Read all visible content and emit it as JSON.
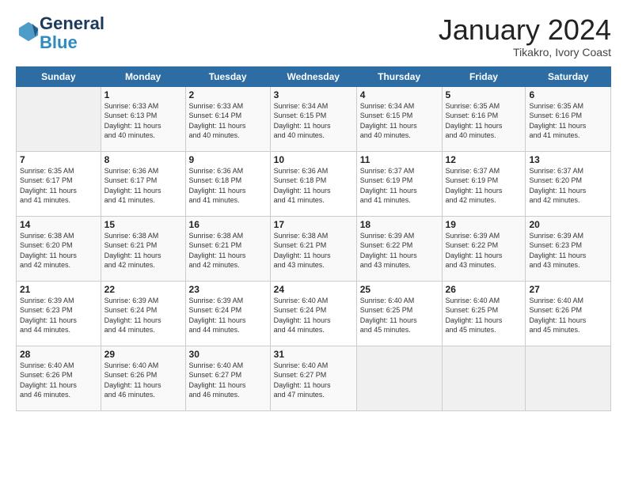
{
  "header": {
    "logo_line1": "General",
    "logo_line2": "Blue",
    "month": "January 2024",
    "location": "Tikakro, Ivory Coast"
  },
  "days_of_week": [
    "Sunday",
    "Monday",
    "Tuesday",
    "Wednesday",
    "Thursday",
    "Friday",
    "Saturday"
  ],
  "weeks": [
    [
      {
        "num": "",
        "info": ""
      },
      {
        "num": "1",
        "info": "Sunrise: 6:33 AM\nSunset: 6:13 PM\nDaylight: 11 hours\nand 40 minutes."
      },
      {
        "num": "2",
        "info": "Sunrise: 6:33 AM\nSunset: 6:14 PM\nDaylight: 11 hours\nand 40 minutes."
      },
      {
        "num": "3",
        "info": "Sunrise: 6:34 AM\nSunset: 6:15 PM\nDaylight: 11 hours\nand 40 minutes."
      },
      {
        "num": "4",
        "info": "Sunrise: 6:34 AM\nSunset: 6:15 PM\nDaylight: 11 hours\nand 40 minutes."
      },
      {
        "num": "5",
        "info": "Sunrise: 6:35 AM\nSunset: 6:16 PM\nDaylight: 11 hours\nand 40 minutes."
      },
      {
        "num": "6",
        "info": "Sunrise: 6:35 AM\nSunset: 6:16 PM\nDaylight: 11 hours\nand 41 minutes."
      }
    ],
    [
      {
        "num": "7",
        "info": "Sunrise: 6:35 AM\nSunset: 6:17 PM\nDaylight: 11 hours\nand 41 minutes."
      },
      {
        "num": "8",
        "info": "Sunrise: 6:36 AM\nSunset: 6:17 PM\nDaylight: 11 hours\nand 41 minutes."
      },
      {
        "num": "9",
        "info": "Sunrise: 6:36 AM\nSunset: 6:18 PM\nDaylight: 11 hours\nand 41 minutes."
      },
      {
        "num": "10",
        "info": "Sunrise: 6:36 AM\nSunset: 6:18 PM\nDaylight: 11 hours\nand 41 minutes."
      },
      {
        "num": "11",
        "info": "Sunrise: 6:37 AM\nSunset: 6:19 PM\nDaylight: 11 hours\nand 41 minutes."
      },
      {
        "num": "12",
        "info": "Sunrise: 6:37 AM\nSunset: 6:19 PM\nDaylight: 11 hours\nand 42 minutes."
      },
      {
        "num": "13",
        "info": "Sunrise: 6:37 AM\nSunset: 6:20 PM\nDaylight: 11 hours\nand 42 minutes."
      }
    ],
    [
      {
        "num": "14",
        "info": "Sunrise: 6:38 AM\nSunset: 6:20 PM\nDaylight: 11 hours\nand 42 minutes."
      },
      {
        "num": "15",
        "info": "Sunrise: 6:38 AM\nSunset: 6:21 PM\nDaylight: 11 hours\nand 42 minutes."
      },
      {
        "num": "16",
        "info": "Sunrise: 6:38 AM\nSunset: 6:21 PM\nDaylight: 11 hours\nand 42 minutes."
      },
      {
        "num": "17",
        "info": "Sunrise: 6:38 AM\nSunset: 6:21 PM\nDaylight: 11 hours\nand 43 minutes."
      },
      {
        "num": "18",
        "info": "Sunrise: 6:39 AM\nSunset: 6:22 PM\nDaylight: 11 hours\nand 43 minutes."
      },
      {
        "num": "19",
        "info": "Sunrise: 6:39 AM\nSunset: 6:22 PM\nDaylight: 11 hours\nand 43 minutes."
      },
      {
        "num": "20",
        "info": "Sunrise: 6:39 AM\nSunset: 6:23 PM\nDaylight: 11 hours\nand 43 minutes."
      }
    ],
    [
      {
        "num": "21",
        "info": "Sunrise: 6:39 AM\nSunset: 6:23 PM\nDaylight: 11 hours\nand 44 minutes."
      },
      {
        "num": "22",
        "info": "Sunrise: 6:39 AM\nSunset: 6:24 PM\nDaylight: 11 hours\nand 44 minutes."
      },
      {
        "num": "23",
        "info": "Sunrise: 6:39 AM\nSunset: 6:24 PM\nDaylight: 11 hours\nand 44 minutes."
      },
      {
        "num": "24",
        "info": "Sunrise: 6:40 AM\nSunset: 6:24 PM\nDaylight: 11 hours\nand 44 minutes."
      },
      {
        "num": "25",
        "info": "Sunrise: 6:40 AM\nSunset: 6:25 PM\nDaylight: 11 hours\nand 45 minutes."
      },
      {
        "num": "26",
        "info": "Sunrise: 6:40 AM\nSunset: 6:25 PM\nDaylight: 11 hours\nand 45 minutes."
      },
      {
        "num": "27",
        "info": "Sunrise: 6:40 AM\nSunset: 6:26 PM\nDaylight: 11 hours\nand 45 minutes."
      }
    ],
    [
      {
        "num": "28",
        "info": "Sunrise: 6:40 AM\nSunset: 6:26 PM\nDaylight: 11 hours\nand 46 minutes."
      },
      {
        "num": "29",
        "info": "Sunrise: 6:40 AM\nSunset: 6:26 PM\nDaylight: 11 hours\nand 46 minutes."
      },
      {
        "num": "30",
        "info": "Sunrise: 6:40 AM\nSunset: 6:27 PM\nDaylight: 11 hours\nand 46 minutes."
      },
      {
        "num": "31",
        "info": "Sunrise: 6:40 AM\nSunset: 6:27 PM\nDaylight: 11 hours\nand 47 minutes."
      },
      {
        "num": "",
        "info": ""
      },
      {
        "num": "",
        "info": ""
      },
      {
        "num": "",
        "info": ""
      }
    ]
  ]
}
